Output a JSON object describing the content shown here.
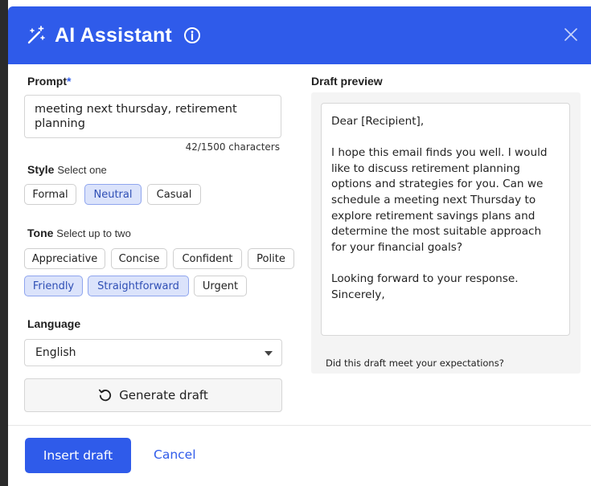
{
  "header": {
    "title": "AI Assistant",
    "icons": [
      "magic-wand-icon",
      "info-icon",
      "close-icon"
    ]
  },
  "prompt": {
    "label": "Prompt",
    "required_mark": "*",
    "value": "meeting next thursday, retirement planning",
    "char_count": "42/1500 characters"
  },
  "style": {
    "label": "Style",
    "hint": "Select one",
    "options": [
      {
        "label": "Formal",
        "selected": false
      },
      {
        "label": "Neutral",
        "selected": true
      },
      {
        "label": "Casual",
        "selected": false
      }
    ]
  },
  "tone": {
    "label": "Tone",
    "hint": "Select up to two",
    "options": [
      {
        "label": "Appreciative",
        "selected": false
      },
      {
        "label": "Concise",
        "selected": false
      },
      {
        "label": "Confident",
        "selected": false
      },
      {
        "label": "Polite",
        "selected": false
      },
      {
        "label": "Friendly",
        "selected": true
      },
      {
        "label": "Straightforward",
        "selected": true
      },
      {
        "label": "Urgent",
        "selected": false
      }
    ]
  },
  "language": {
    "label": "Language",
    "selected": "English"
  },
  "generate": {
    "label": "Generate draft"
  },
  "preview": {
    "label": "Draft preview",
    "text": "Dear [Recipient],\n\nI hope this email finds you well. I would like to discuss retirement planning options and strategies for you. Can we schedule a meeting next Thursday to explore retirement savings plans and determine the most suitable approach for your financial goals?\n\nLooking forward to your response.\nSincerely,",
    "feedback": "Did this draft meet your expectations?"
  },
  "footer": {
    "insert_label": "Insert draft",
    "cancel_label": "Cancel"
  },
  "colors": {
    "accent": "#2f5bea",
    "chip_selected_bg": "#dbe3fb"
  }
}
